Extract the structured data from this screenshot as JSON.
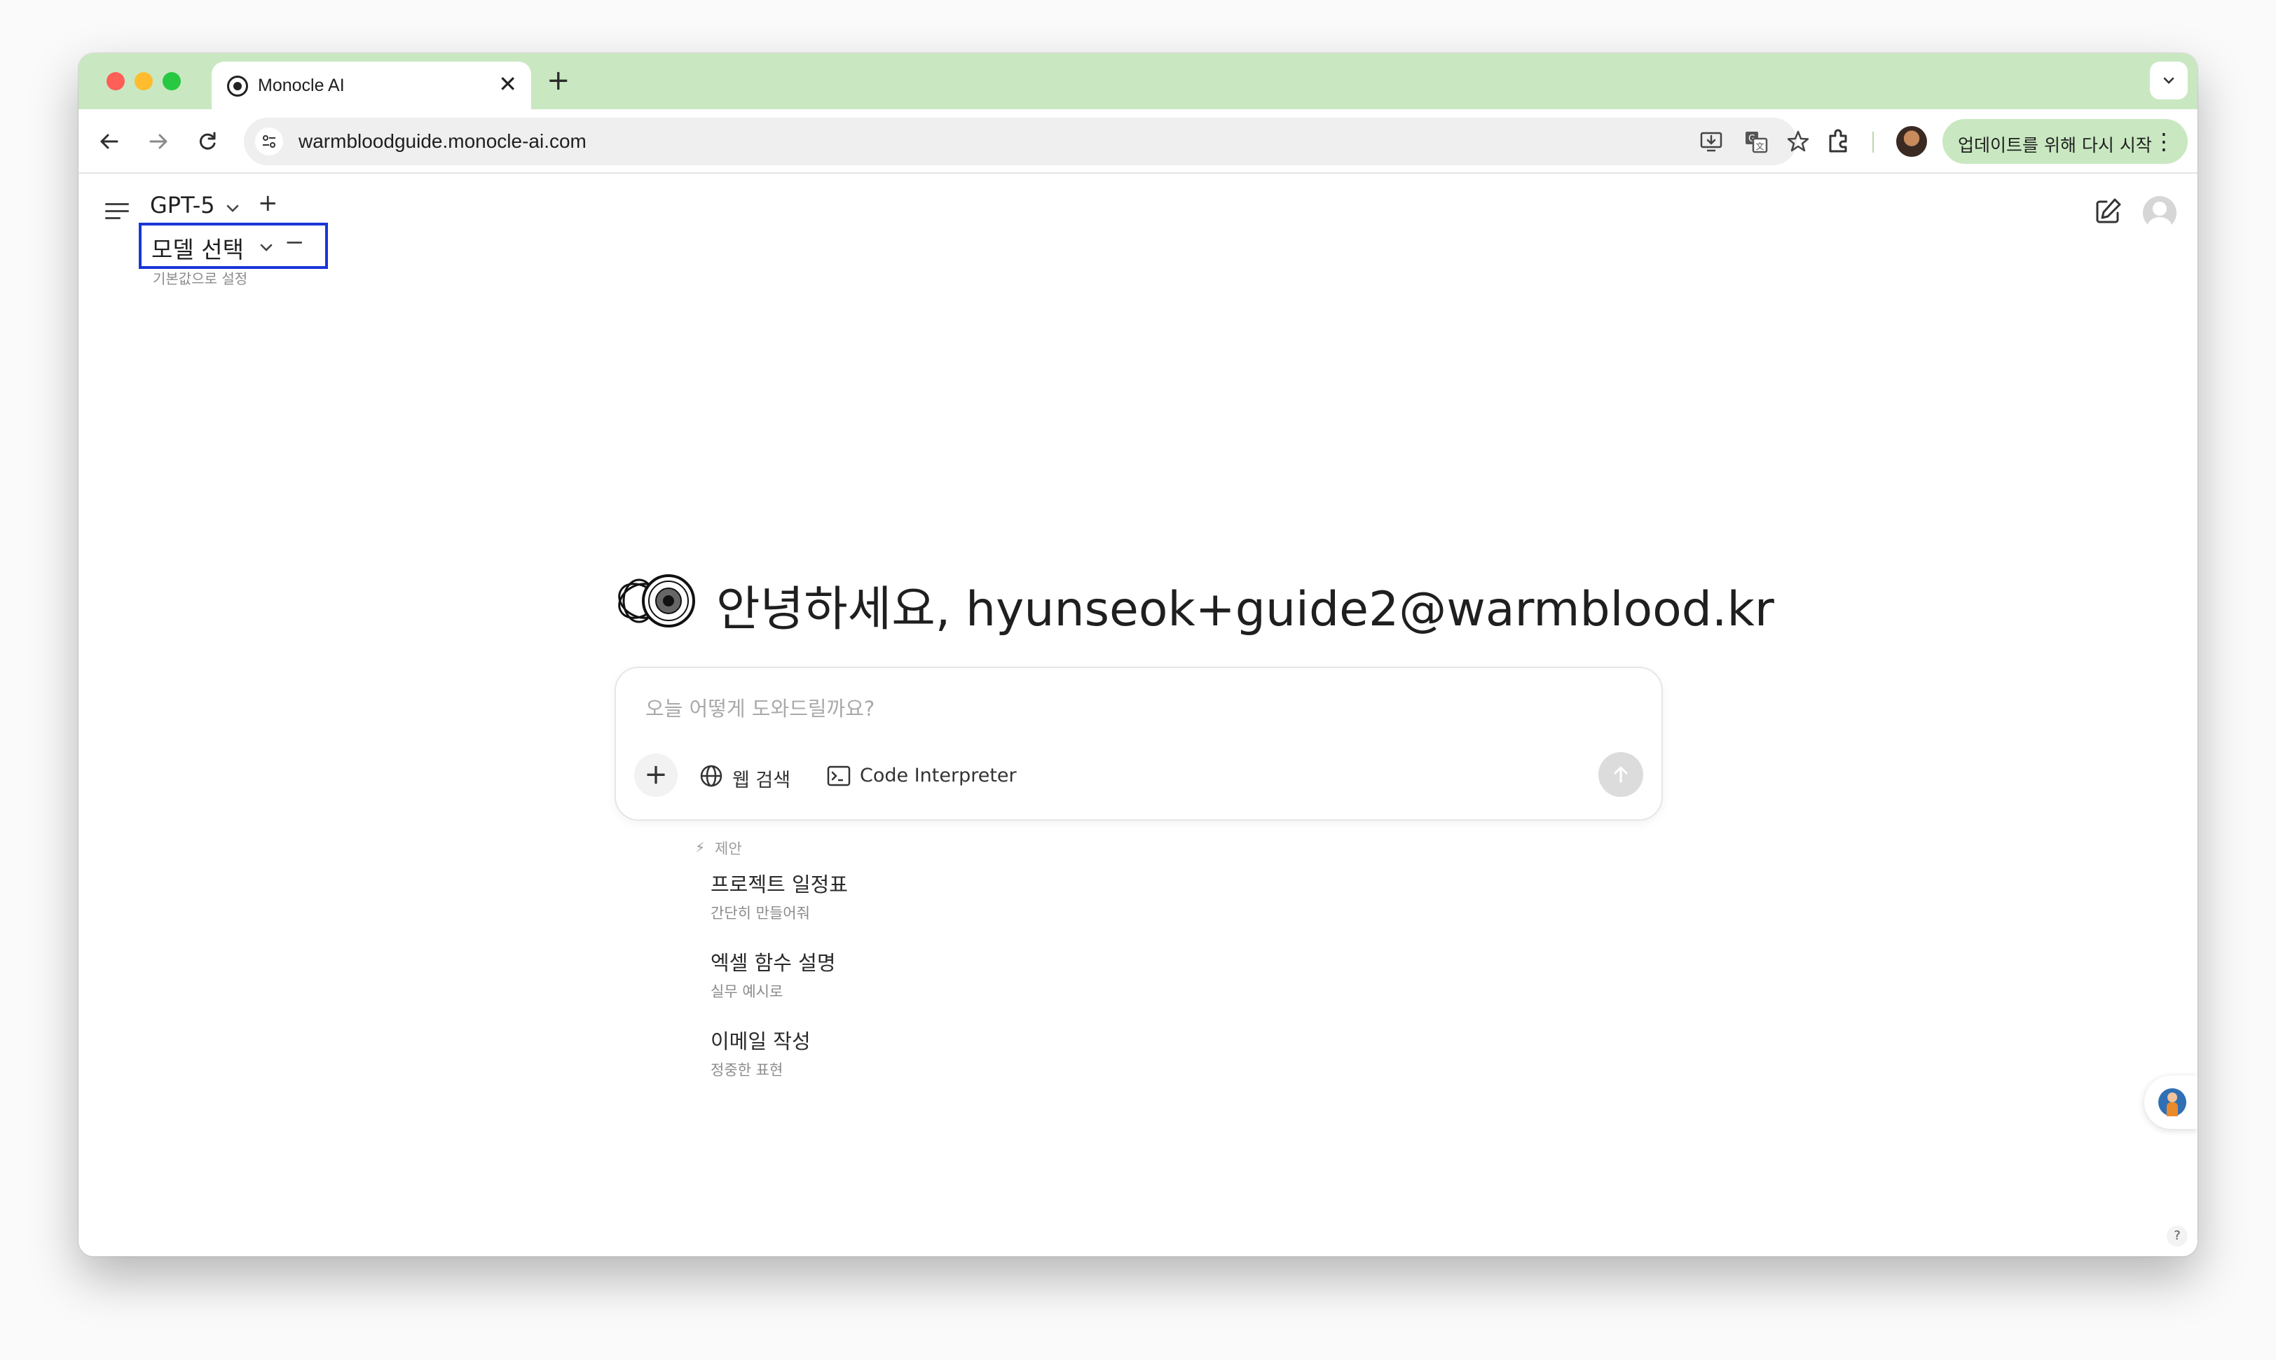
{
  "browser": {
    "tab": {
      "title": "Monocle AI",
      "close": "✕"
    },
    "new_tab": "+",
    "tab_dropdown": "⌄",
    "url": "warmbloodguide.monocle-ai.com",
    "update_button": "업데이트를 위해 다시 시작",
    "menu": "⋮",
    "icons": [
      "back-icon",
      "forward-icon",
      "reload-icon",
      "site-info-icon",
      "install-app-icon",
      "translate-icon",
      "bookmark-star-icon",
      "extensions-icon",
      "profile-avatar"
    ]
  },
  "header": {
    "model_name": "GPT-5",
    "model_chevron": "⌄",
    "add_model": "+",
    "model_select_label": "모델 선택",
    "remove_model": "−",
    "default_link": "기본값으로 설정"
  },
  "main": {
    "greeting": "안녕하세요, hyunseok+guide2@warmblood.kr",
    "composer": {
      "placeholder": "오늘 어떻게 도와드릴까요?",
      "attach": "+",
      "web_search": "웹 검색",
      "code_interpreter": "Code Interpreter",
      "send": "↑"
    },
    "suggestions": {
      "header_icon": "⚡",
      "header": "제안",
      "items": [
        {
          "title": "프로젝트 일정표",
          "subtitle": "간단히 만들어줘"
        },
        {
          "title": "엑셀 함수 설명",
          "subtitle": "실무 예시로"
        },
        {
          "title": "이메일 작성",
          "subtitle": "정중한 표현"
        }
      ]
    }
  },
  "help": "?",
  "colors": {
    "tabstrip": "#c9e8c1",
    "highlight_border": "#1a35d8",
    "send_disabled": "#dcdcdc"
  }
}
